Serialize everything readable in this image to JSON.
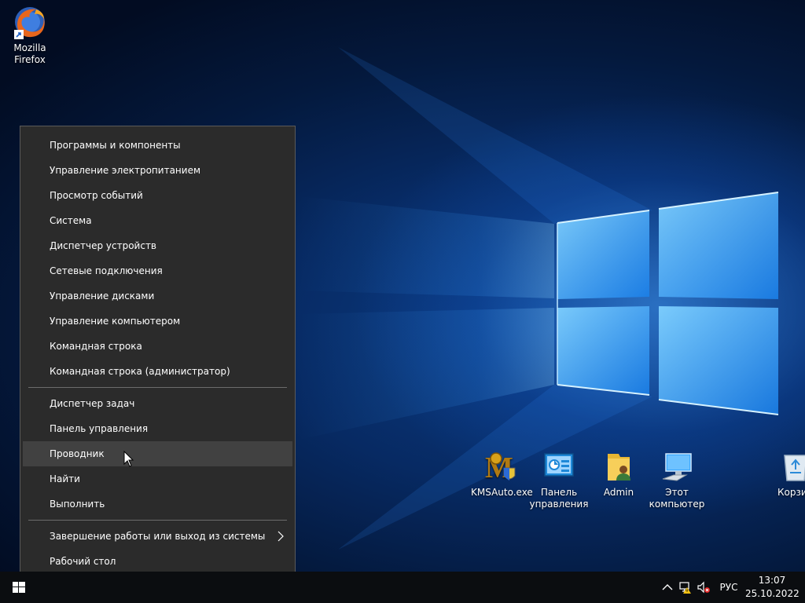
{
  "desktop": {
    "icons": {
      "firefox": {
        "label": "Mozilla\nFirefox",
        "icon": "firefox-icon"
      },
      "kmsauto": {
        "label": "KMSAuto.exe",
        "icon": "kmsauto-icon"
      },
      "control_panel": {
        "label": "Панель\nуправления",
        "icon": "control-panel-icon"
      },
      "admin": {
        "label": "Admin",
        "icon": "user-folder-icon"
      },
      "this_pc": {
        "label": "Этот\nкомпьютер",
        "icon": "computer-icon"
      },
      "recycle_bin": {
        "label": "Корзина",
        "icon": "recycle-bin-icon"
      }
    }
  },
  "menu": {
    "group1": [
      "Программы и компоненты",
      "Управление электропитанием",
      "Просмотр событий",
      "Система",
      "Диспетчер устройств",
      "Сетевые подключения",
      "Управление дисками",
      "Управление компьютером",
      "Командная строка",
      "Командная строка (администратор)"
    ],
    "group2": [
      "Диспетчер задач",
      "Панель управления",
      "Проводник",
      "Найти",
      "Выполнить"
    ],
    "group3": [
      "Завершение работы или выход из системы",
      "Рабочий стол"
    ],
    "hovered_item": "Проводник"
  },
  "taskbar": {
    "language": "РУС",
    "time": "13:07",
    "date": "25.10.2022"
  },
  "colors": {
    "menu_bg": "#2b2b2b",
    "menu_hover": "#414141",
    "taskbar_bg": "#0b0d10",
    "accent_blue": "#1f8fff"
  }
}
